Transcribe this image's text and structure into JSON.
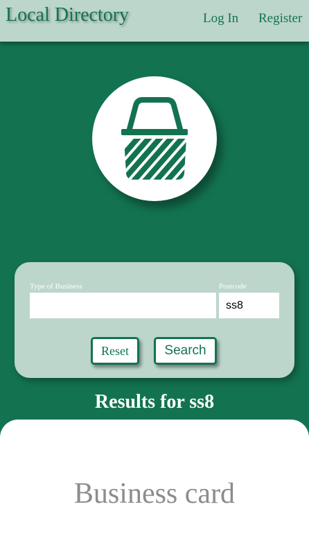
{
  "header": {
    "brand": "Local Directory",
    "nav": {
      "login": "Log In",
      "register": "Register"
    }
  },
  "logo": {
    "icon": "shopping-basket-icon"
  },
  "search": {
    "business_label": "Type of Business",
    "business_value": "",
    "postcode_label": "Postcode",
    "postcode_value": "ss8",
    "reset_label": "Reset",
    "search_label": "Search"
  },
  "results": {
    "heading": "Results for ss8",
    "card_title": "Business card"
  },
  "colors": {
    "primary": "#137350",
    "panel": "#bcd6cb",
    "card": "#ffffff"
  }
}
